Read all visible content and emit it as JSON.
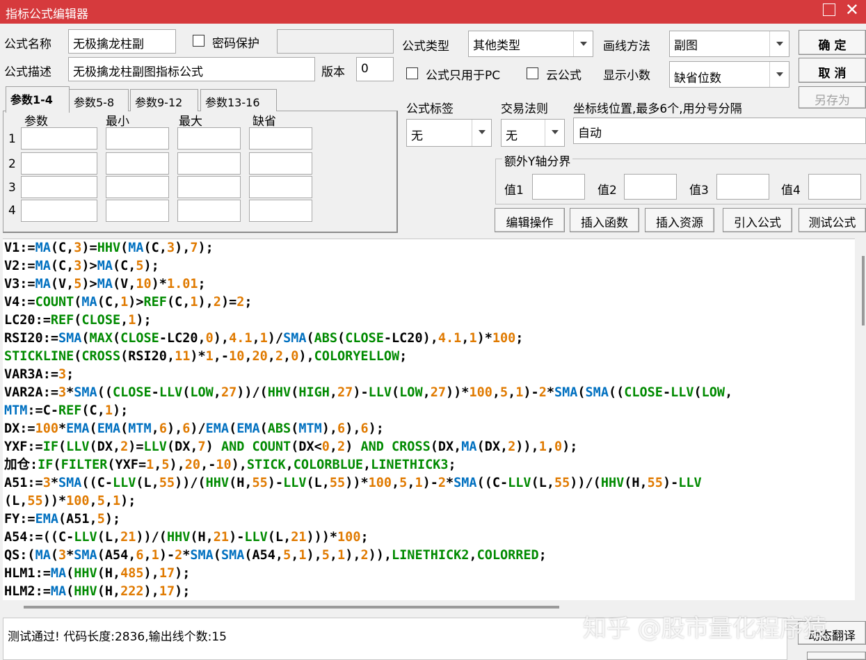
{
  "window": {
    "title": "指标公式编辑器"
  },
  "form": {
    "name_label": "公式名称",
    "name_value": "无极擒龙柱副",
    "password_label": "密码保护",
    "desc_label": "公式描述",
    "desc_value": "无极擒龙柱副图指标公式",
    "version_label": "版本",
    "version_value": "0",
    "type_label": "公式类型",
    "type_value": "其他类型",
    "draw_label": "画线方法",
    "draw_value": "副图",
    "pc_only_label": "公式只用于PC",
    "cloud_label": "云公式",
    "decimals_label": "显示小数",
    "decimals_value": "缺省位数",
    "tag_label": "公式标签",
    "tag_value": "无",
    "trade_label": "交易法则",
    "trade_value": "无",
    "coord_label": "坐标线位置,最多6个,用分号分隔",
    "coord_value": "自动",
    "yaxis_label": "额外Y轴分界",
    "y_values": [
      "值1",
      "值2",
      "值3",
      "值4"
    ]
  },
  "buttons": {
    "ok": "确 定",
    "cancel": "取 消",
    "save_as": "另存为"
  },
  "tabs": [
    "参数1-4",
    "参数5-8",
    "参数9-12",
    "参数13-16"
  ],
  "params": {
    "headers": [
      "参数",
      "最小",
      "最大",
      "缺省"
    ],
    "rows": [
      "1",
      "2",
      "3",
      "4"
    ]
  },
  "toolbar": [
    "编辑操作",
    "插入函数",
    "插入资源",
    "引入公式",
    "测试公式"
  ],
  "code_lines": [
    "V1:=MA(C,3)=HHV(MA(C,3),7);",
    "V2:=MA(C,3)>MA(C,5);",
    "V3:=MA(V,5)>MA(V,10)*1.01;",
    "V4:=COUNT(MA(C,1)>REF(C,1),2)=2;",
    "LC20:=REF(CLOSE,1);",
    "RSI20:=SMA(MAX(CLOSE-LC20,0),4.1,1)/SMA(ABS(CLOSE-LC20),4.1,1)*100;",
    "STICKLINE(CROSS(RSI20,11)*1,-10,20,2,0),COLORYELLOW;",
    "VAR3A:=3;",
    "VAR2A:=3*SMA((CLOSE-LLV(LOW,27))/(HHV(HIGH,27)-LLV(LOW,27))*100,5,1)-2*SMA(SMA((CLOSE-LLV(LOW,",
    "MTM:=C-REF(C,1);",
    "DX:=100*EMA(EMA(MTM,6),6)/EMA(EMA(ABS(MTM),6),6);",
    "YXF:=IF(LLV(DX,2)=LLV(DX,7) AND COUNT(DX<0,2) AND CROSS(DX,MA(DX,2)),1,0);",
    "加仓:IF(FILTER(YXF=1,5),20,-10),STICK,COLORBLUE,LINETHICK3;",
    "A51:=3*SMA((C-LLV(L,55))/(HHV(H,55)-LLV(L,55))*100,5,1)-2*SMA((C-LLV(L,55))/(HHV(H,55)-LLV",
    "(L,55))*100,5,1);",
    "FY:=EMA(A51,5);",
    "A54:=((C-LLV(L,21))/(HHV(H,21)-LLV(L,21)))*100;",
    "QS:(MA(3*SMA(A54,6,1)-2*SMA(SMA(A54,5,1),5,1),2)),LINETHICK2,COLORRED;",
    "HLM1:=MA(HHV(H,485),17);",
    "HLM2:=MA(HHV(H,222),17);"
  ],
  "status": {
    "text": "测试通过! 代码长度:2836,输出线个数:15",
    "side_button": "动态翻译"
  },
  "watermark": "知乎 @股市量化程序猿"
}
